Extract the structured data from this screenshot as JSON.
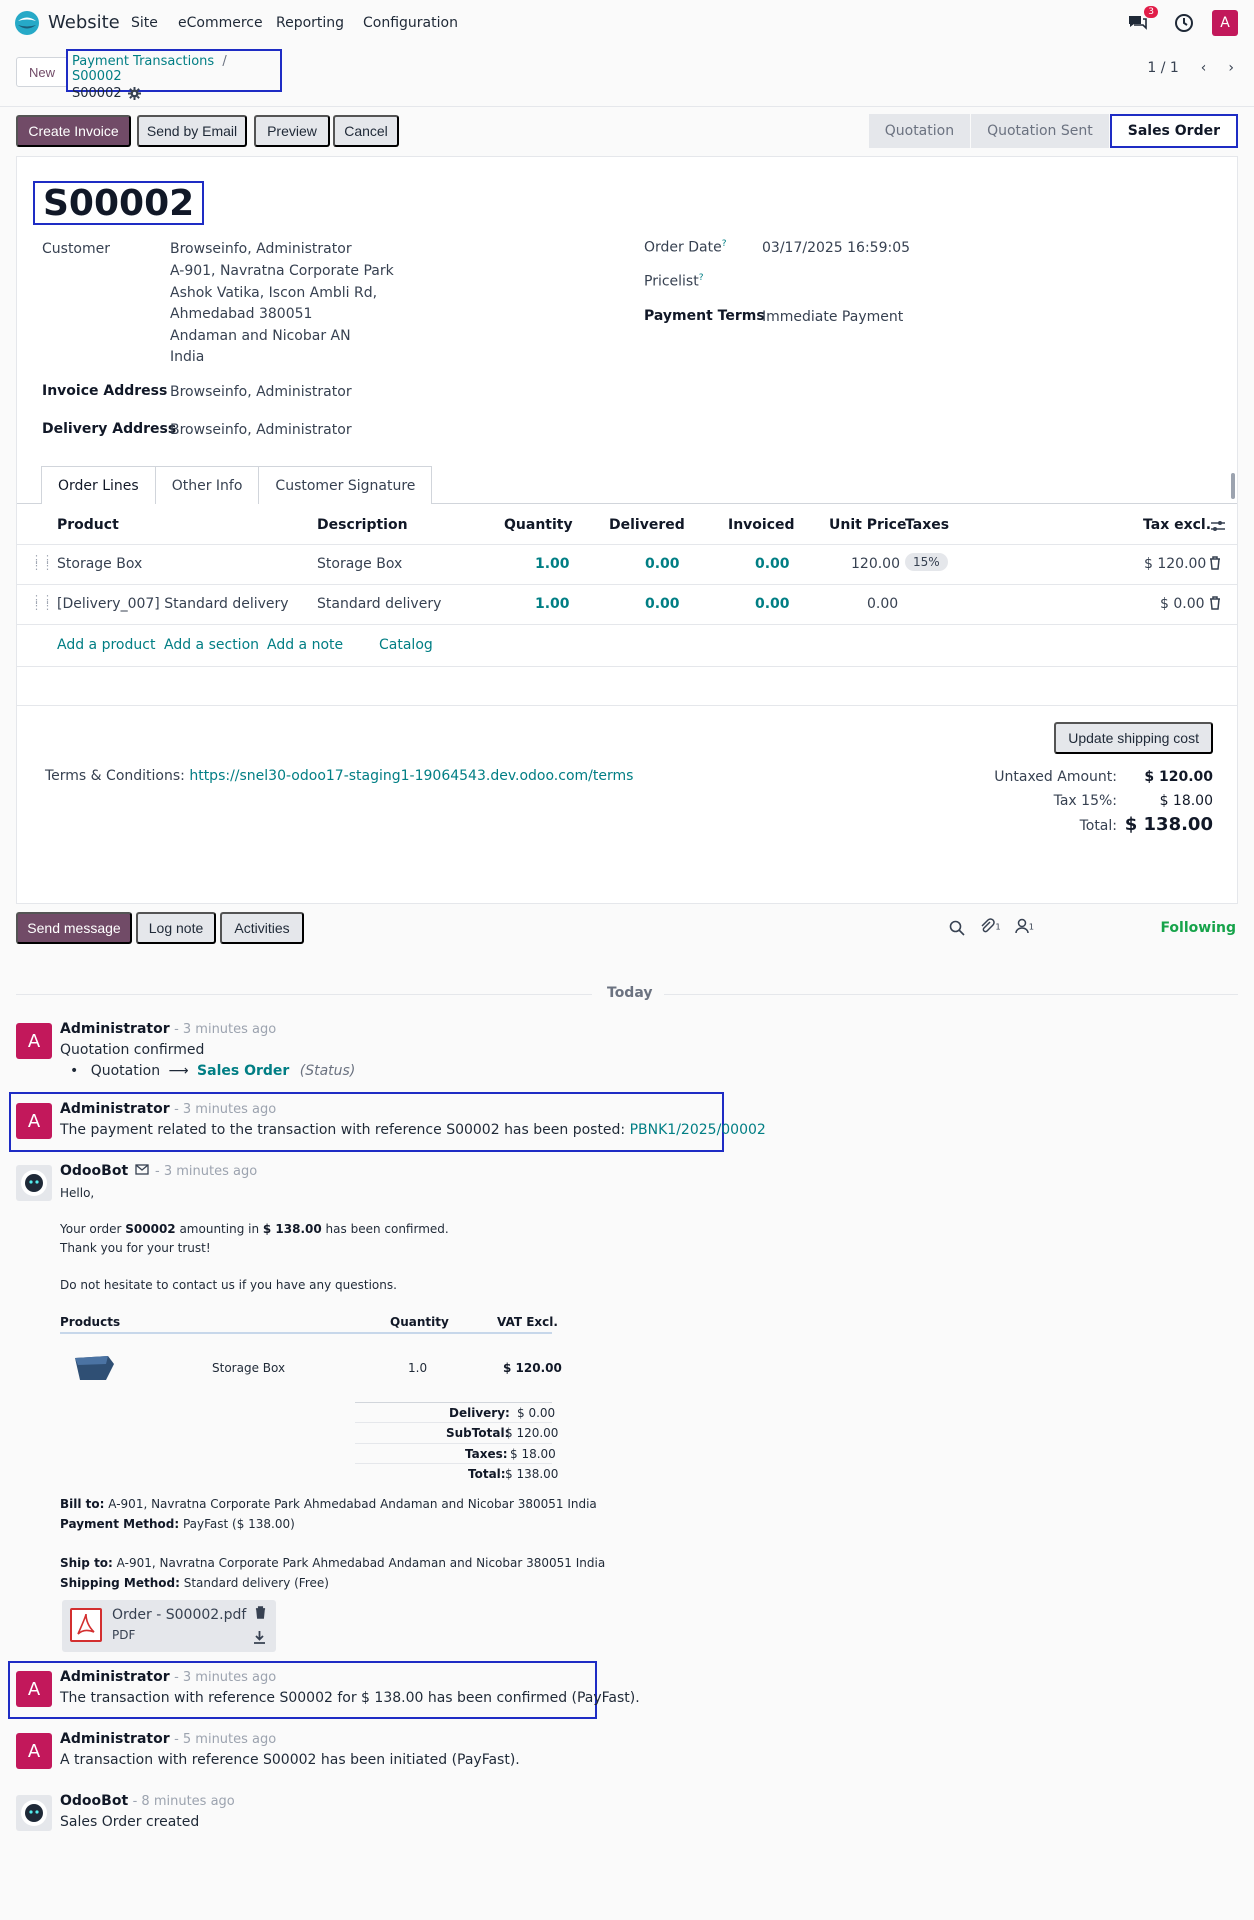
{
  "navbar": {
    "app_name": "Website",
    "menus": [
      "Site",
      "eCommerce",
      "Reporting",
      "Configuration"
    ],
    "chat_count": "3",
    "user_initial": "A"
  },
  "breadcrumb": {
    "new_label": "New",
    "parent": "Payment Transactions",
    "separator": "/",
    "current": "S00002",
    "record_name": "S00002"
  },
  "pager": {
    "value": "1 / 1"
  },
  "actions": {
    "create_invoice": "Create Invoice",
    "send_by_email": "Send by Email",
    "preview": "Preview",
    "cancel": "Cancel"
  },
  "statusbar": {
    "stages": [
      "Quotation",
      "Quotation Sent",
      "Sales Order"
    ],
    "active": "Sales Order"
  },
  "form": {
    "title": "S00002",
    "customer_label": "Customer",
    "customer_name": "Browseinfo, Administrator",
    "customer_address": [
      "A-901, Navratna Corporate Park",
      "Ashok Vatika, Iscon Ambli Rd,",
      "Ahmedabad 380051",
      "Andaman and Nicobar AN",
      "India"
    ],
    "invoice_address_label": "Invoice Address",
    "invoice_address": "Browseinfo, Administrator",
    "delivery_address_label": "Delivery Address",
    "delivery_address": "Browseinfo, Administrator",
    "order_date_label": "Order Date",
    "order_date": "03/17/2025 16:59:05",
    "pricelist_label": "Pricelist",
    "payment_terms_label": "Payment Terms",
    "payment_terms": "Immediate Payment",
    "help_mark": "?"
  },
  "tabs": [
    "Order Lines",
    "Other Info",
    "Customer Signature"
  ],
  "order_lines": {
    "headers": {
      "product": "Product",
      "description": "Description",
      "quantity": "Quantity",
      "delivered": "Delivered",
      "invoiced": "Invoiced",
      "unit_price": "Unit Price",
      "taxes": "Taxes",
      "tax_excl": "Tax excl."
    },
    "rows": [
      {
        "product": "Storage Box",
        "description": "Storage Box",
        "quantity": "1.00",
        "delivered": "0.00",
        "invoiced": "0.00",
        "unit_price": "120.00",
        "taxes": "15%",
        "subtotal": "$ 120.00"
      },
      {
        "product": "[Delivery_007] Standard delivery",
        "description": "Standard delivery",
        "quantity": "1.00",
        "delivered": "0.00",
        "invoiced": "0.00",
        "unit_price": "0.00",
        "taxes": "",
        "subtotal": "$ 0.00"
      }
    ],
    "links": [
      "Add a product",
      "Add a section",
      "Add a note",
      "Catalog"
    ]
  },
  "footer": {
    "update_shipping": "Update shipping cost",
    "terms_label": "Terms & Conditions:",
    "terms_url": "https://snel30-odoo17-staging1-19064543.dev.odoo.com/terms",
    "untaxed_label": "Untaxed Amount:",
    "untaxed_value": "$ 120.00",
    "tax_label": "Tax 15%:",
    "tax_value": "$ 18.00",
    "total_label": "Total:",
    "total_value": "$ 138.00"
  },
  "chatter": {
    "send_message": "Send message",
    "log_note": "Log note",
    "activities": "Activities",
    "attachments_count": "1",
    "followers_count": "1",
    "following": "Following",
    "today": "Today"
  },
  "messages": {
    "m1": {
      "author": "Administrator",
      "ago": "- 3 minutes ago",
      "body": "Quotation confirmed",
      "from": "Quotation",
      "to": "Sales Order",
      "field": "(Status)"
    },
    "m2": {
      "author": "Administrator",
      "ago": "- 3 minutes ago",
      "body": "The payment related to the transaction with reference S00002 has been posted:",
      "link": "PBNK1/2025/00002"
    },
    "m3": {
      "author": "OdooBot",
      "ago": "- 3 minutes ago"
    },
    "m4": {
      "author": "Administrator",
      "ago": "- 3 minutes ago",
      "body": "The transaction with reference S00002 for $ 138.00 has been confirmed (PayFast)."
    },
    "m5": {
      "author": "Administrator",
      "ago": "- 5 minutes ago",
      "body": "A transaction with reference S00002 has been initiated (PayFast)."
    },
    "m6": {
      "author": "OdooBot",
      "ago": "- 8 minutes ago",
      "body": "Sales Order created"
    }
  },
  "email": {
    "hello": "Hello,",
    "line1_a": "Your order ",
    "line1_order": "S00002",
    "line1_b": " amounting in ",
    "line1_amount": "$ 138.00",
    "line1_c": " has been confirmed.",
    "thanks": "Thank you for your trust!",
    "contact": "Do not hesitate to contact us if you have any questions.",
    "col_products": "Products",
    "col_quantity": "Quantity",
    "col_vat": "VAT Excl.",
    "item_name": "Storage Box",
    "item_qty": "1.0",
    "item_price": "$ 120.00",
    "delivery_label": "Delivery:",
    "delivery_value": "$ 0.00",
    "subtotal_label": "SubTotal:",
    "subtotal_value": "$ 120.00",
    "taxes_label": "Taxes:",
    "taxes_value": "$ 18.00",
    "total_label": "Total:",
    "total_value": "$ 138.00",
    "bill_to_label": "Bill to:",
    "bill_to": " A-901, Navratna Corporate Park Ahmedabad Andaman and Nicobar 380051 India",
    "payment_method_label": "Payment Method:",
    "payment_method": " PayFast ($ 138.00)",
    "ship_to_label": "Ship to:",
    "ship_to": " A-901, Navratna Corporate Park Ahmedabad Andaman and Nicobar 380051 India",
    "shipping_method_label": "Shipping Method:",
    "shipping_method": " Standard delivery (Free)",
    "attachment_name": "Order - S00002.pdf",
    "attachment_type": "PDF"
  }
}
